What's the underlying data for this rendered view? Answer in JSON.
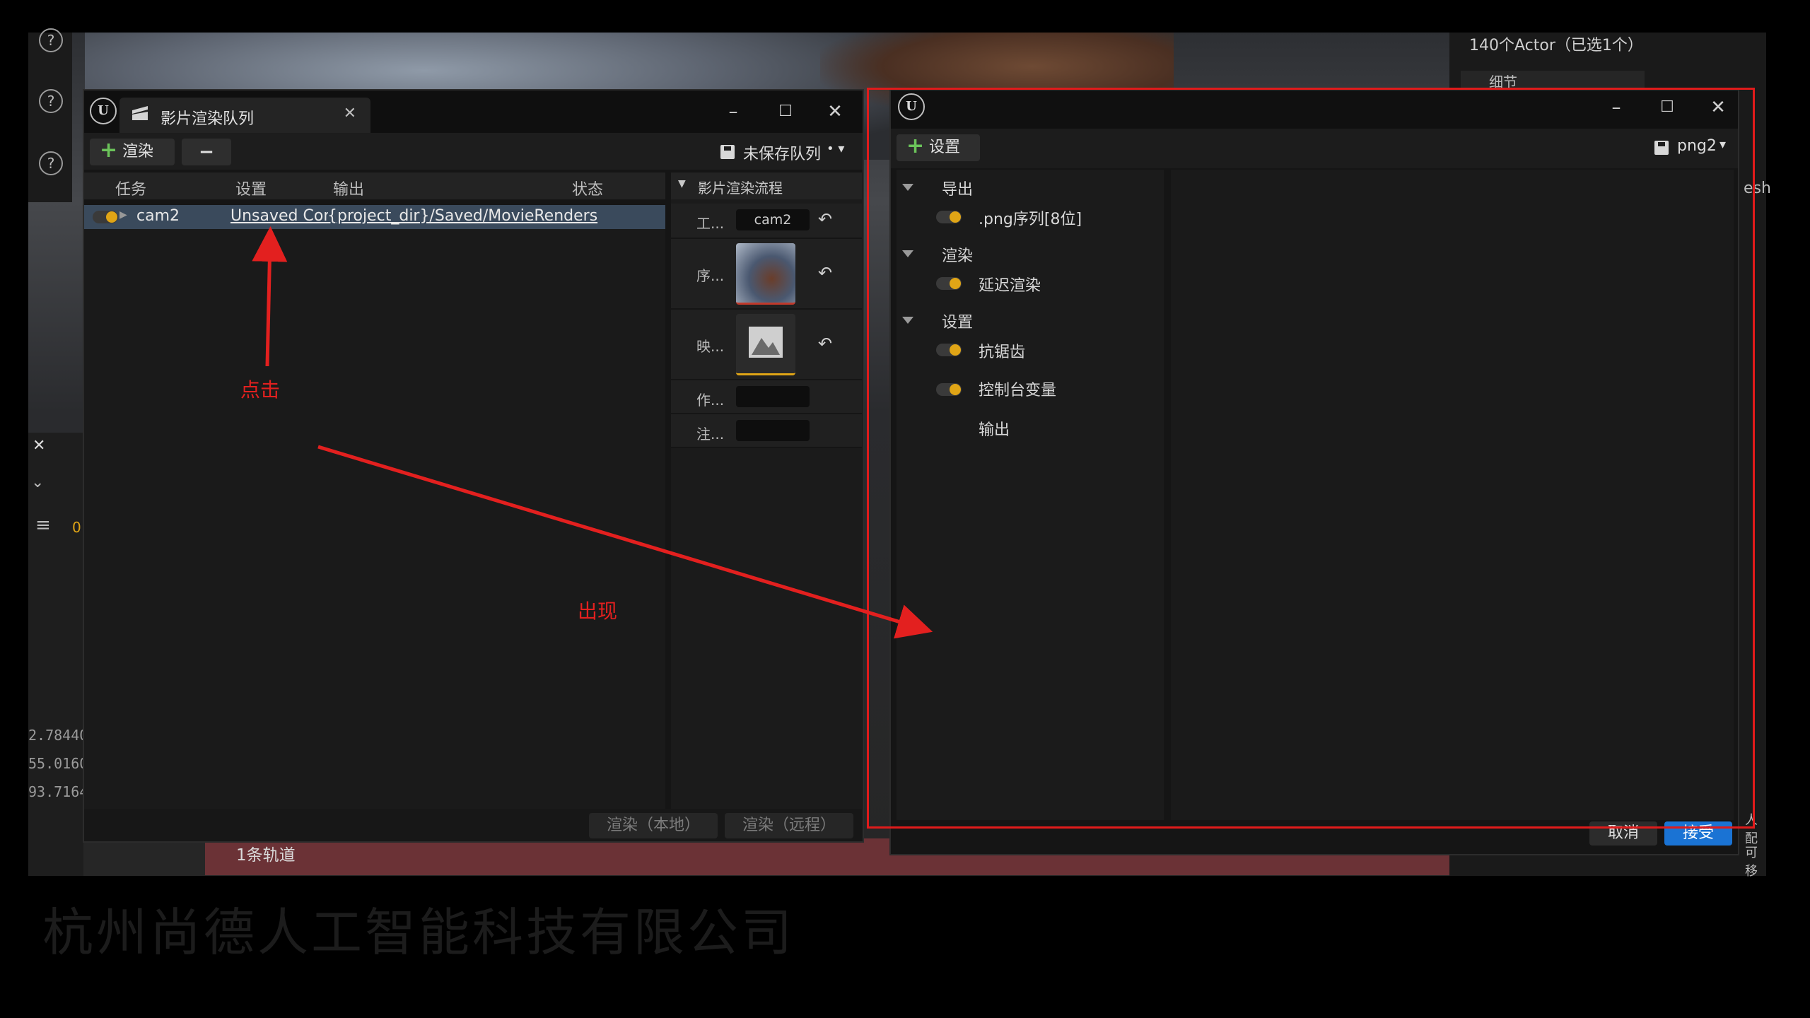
{
  "background": {
    "outliner_count": "140个Actor（已选1个）",
    "outliner_details_tab": "细节",
    "side_numbers": [
      "2.78440",
      "55.0160",
      "93.7164"
    ],
    "left_panel_zero": "0",
    "sequencer_track": "1条轨道",
    "right_edge_text": "esh",
    "right_edge_text2": "人配",
    "right_edge_text3": "可移",
    "blurred_caption": "杭州尚德人工智能科技有限公司"
  },
  "queue_window": {
    "tab_title": "影片渲染队列",
    "add_render_label": "渲染",
    "unsaved_queue_label": "未保存队列",
    "columns": [
      "任务",
      "设置",
      "输出",
      "状态"
    ],
    "jobs": [
      {
        "name": "cam2",
        "settings": "Unsaved Con",
        "output": "{project_dir}/Saved/MovieRenders",
        "status": ""
      }
    ],
    "pipeline_header": "影片渲染流程",
    "pipeline_rows": [
      {
        "label": "工...",
        "value": "cam2"
      },
      {
        "label": "序...",
        "value": ""
      },
      {
        "label": "映...",
        "value": ""
      },
      {
        "label": "作...",
        "value": ""
      },
      {
        "label": "注...",
        "value": ""
      }
    ],
    "render_local_label": "渲染（本地）",
    "render_remote_label": "渲染（远程）"
  },
  "settings_window": {
    "add_setting_label": "设置",
    "preset_label": "png2",
    "categories": [
      {
        "name": "导出",
        "items": [
          {
            "label": ".png序列[8位]",
            "enabled": true
          }
        ]
      },
      {
        "name": "渲染",
        "items": [
          {
            "label": "延迟渲染",
            "enabled": true
          }
        ]
      },
      {
        "name": "设置",
        "items": [
          {
            "label": "抗锯齿",
            "enabled": true
          },
          {
            "label": "控制台变量",
            "enabled": true
          },
          {
            "label": "输出",
            "enabled": null
          }
        ]
      }
    ],
    "cancel_label": "取消",
    "accept_label": "接受"
  },
  "annotations": {
    "click_label": "点击",
    "appear_label": "出现",
    "color": "#e3201f"
  },
  "colors": {
    "toggle_on": "#e0a516",
    "accept_button": "#1a73d4",
    "selected_row": "#3a4a5c",
    "plus_icon": "#6bc35a"
  }
}
